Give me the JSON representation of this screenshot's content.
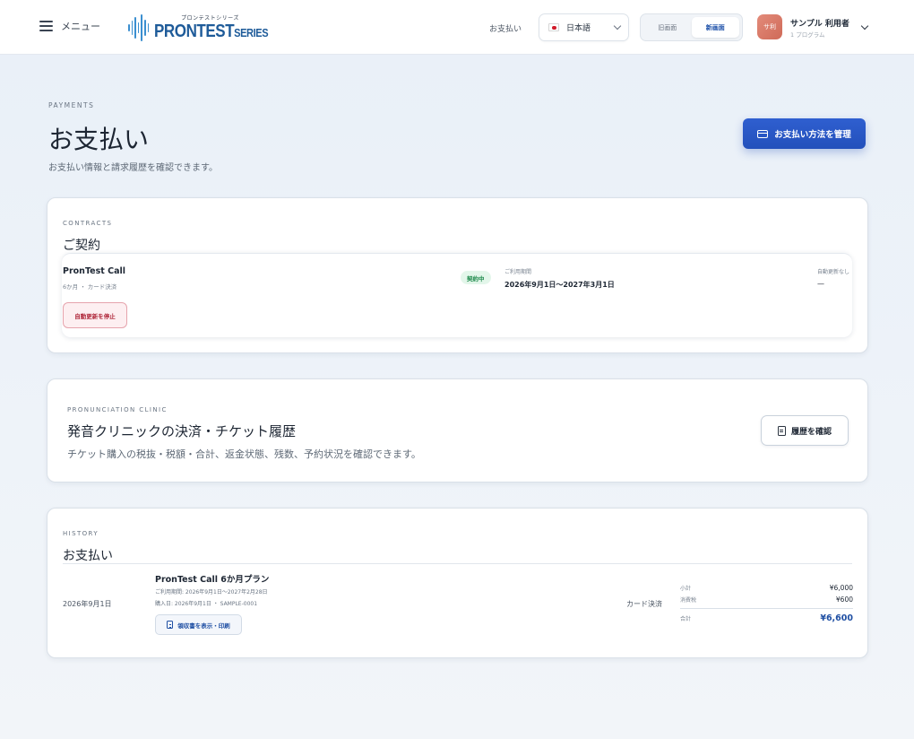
{
  "header": {
    "menu_label": "メニュー",
    "logo_sub": "プロンテストシリーズ",
    "logo_main": "PRONTEST",
    "logo_series": "SERIES",
    "nav_link": "お支払い",
    "language": "日本語",
    "view_toggle": {
      "old": "旧画面",
      "new": "新画面",
      "selected": "新画面"
    },
    "user": {
      "avatar_text": "サ利",
      "name": "サンプル 利用者",
      "sub": "1 プログラム"
    }
  },
  "page": {
    "eyebrow": "PAYMENTS",
    "title": "お支払い",
    "description": "お支払い情報と請求履歴を確認できます。",
    "manage_button": "お支払い方法を管理"
  },
  "contracts": {
    "eyebrow": "CONTRACTS",
    "title": "ご契約",
    "item": {
      "name": "PronTest Call",
      "meta": "6か月 ・ カード決済",
      "status": "契約中",
      "period_label": "ご利用期間",
      "period": "2026年9月1日〜2027年3月1日",
      "auto_renew_label": "自動更新なし",
      "auto_renew_value": "—",
      "stop_button": "自動更新を停止"
    }
  },
  "clinic": {
    "eyebrow": "PRONUNCIATION CLINIC",
    "title": "発音クリニックの決済・チケット履歴",
    "description": "チケット購入の税抜・税額・合計、返金状態、残数、予約状況を確認できます。",
    "history_button": "履歴を確認"
  },
  "history": {
    "eyebrow": "HISTORY",
    "title": "お支払い",
    "row": {
      "date": "2026年9月1日",
      "plan": "PronTest Call 6か月プラン",
      "period": "ご利用期間: 2026年9月1日〜2027年2月28日",
      "purchase": "購入日: 2026年9月1日 ・ SAMPLE-0001",
      "receipt_button": "領収書を表示・印刷",
      "method": "カード決済",
      "subtotal_label": "小計",
      "subtotal": "¥6,000",
      "tax_label": "消費税",
      "tax": "¥600",
      "total_label": "合計",
      "total": "¥6,600"
    }
  },
  "colors": {
    "accent": "#2350bb",
    "status_active_bg": "#e3f6ea",
    "status_active_text": "#1f8a4c",
    "danger": "#b0283b"
  }
}
